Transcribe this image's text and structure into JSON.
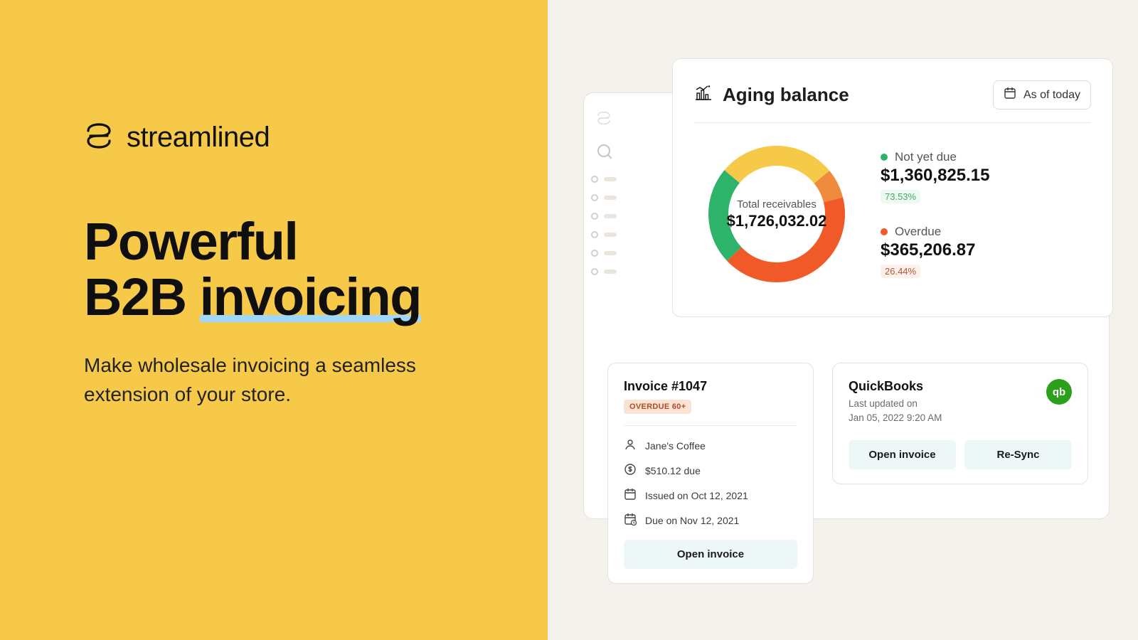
{
  "brand": {
    "name": "streamlined"
  },
  "hero": {
    "headline_line1": "Powerful",
    "headline_line2_pre": "B2B ",
    "headline_line2_underlined": "invoicing",
    "sub": "Make wholesale invoicing a seamless extension of your store."
  },
  "aging": {
    "title": "Aging balance",
    "asof_label": "As of today",
    "center_label": "Total receivables",
    "center_value": "$1,726,032.02",
    "legend": {
      "not_due": {
        "label": "Not yet due",
        "amount": "$1,360,825.15",
        "pct": "73.53%",
        "color": "#2db36a"
      },
      "overdue": {
        "label": "Overdue",
        "amount": "$365,206.87",
        "pct": "26.44%",
        "color": "#f05a28"
      }
    }
  },
  "invoice": {
    "title": "Invoice #1047",
    "badge": "OVERDUE 60+",
    "customer": "Jane's Coffee",
    "due_amount": "$510.12 due",
    "issued": "Issued on Oct 12, 2021",
    "due_date": "Due on Nov 12, 2021",
    "open_label": "Open invoice"
  },
  "quickbooks": {
    "title": "QuickBooks",
    "updated_label": "Last updated on",
    "updated_value": "Jan 05, 2022 9:20 AM",
    "open_label": "Open invoice",
    "resync_label": "Re-Sync"
  },
  "chart_data": {
    "type": "pie",
    "title": "Aging balance — Total receivables",
    "total": 1726032.02,
    "series": [
      {
        "name": "Not yet due",
        "value": 1360825.15,
        "pct": 73.53,
        "color": "#2db36a"
      },
      {
        "name": "Overdue",
        "value": 365206.87,
        "pct": 26.44,
        "color": "#f05a28"
      }
    ],
    "ring_segments_visual": [
      {
        "color": "#f7c948",
        "approx_pct": 28
      },
      {
        "color": "#f08a3c",
        "approx_pct": 7
      },
      {
        "color": "#f05a28",
        "approx_pct": 42
      },
      {
        "color": "#2db36a",
        "approx_pct": 23
      }
    ]
  }
}
